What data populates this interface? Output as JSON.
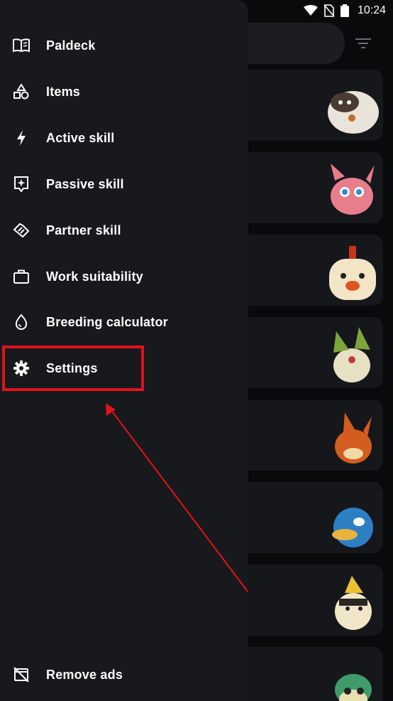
{
  "status_bar": {
    "time": "10:24",
    "icons": [
      "wifi-icon",
      "no-sim-icon",
      "battery-icon"
    ]
  },
  "drawer": {
    "items": [
      {
        "label": "Paldeck",
        "icon": "book-icon"
      },
      {
        "label": "Items",
        "icon": "shapes-icon"
      },
      {
        "label": "Active skill",
        "icon": "bolt-icon"
      },
      {
        "label": "Passive skill",
        "icon": "sparkle-badge-icon"
      },
      {
        "label": "Partner skill",
        "icon": "handshake-icon"
      },
      {
        "label": "Work suitability",
        "icon": "briefcase-icon"
      },
      {
        "label": "Breeding calculator",
        "icon": "egg-icon"
      },
      {
        "label": "Settings",
        "icon": "gear-icon"
      }
    ],
    "footer": {
      "label": "Remove ads",
      "icon": "ads-off-icon"
    }
  },
  "background": {
    "pals": [
      "sheep-pal",
      "pink-cat-pal",
      "chicken-pal",
      "leaf-pal",
      "fox-pal",
      "penguin-pal",
      "electric-pal",
      "green-pal"
    ]
  },
  "colors": {
    "drawer_bg": "#18191d",
    "screen_bg": "#090a0c",
    "annotation": "#e0131b"
  }
}
